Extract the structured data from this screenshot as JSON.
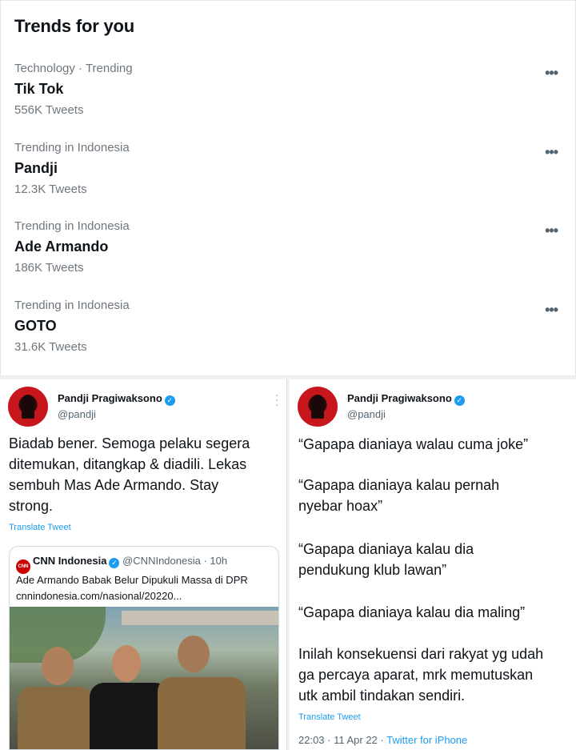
{
  "trends": {
    "title": "Trends for you",
    "items": [
      {
        "context": "Technology · Trending",
        "name": "Tik Tok",
        "count": "556K Tweets",
        "more": "•••"
      },
      {
        "context": "Trending in Indonesia",
        "name": "Pandji",
        "count": "12.3K Tweets",
        "more": "•••"
      },
      {
        "context": "Trending in Indonesia",
        "name": "Ade Armando",
        "count": "186K Tweets",
        "more": "•••"
      },
      {
        "context": "Trending in Indonesia",
        "name": "GOTO",
        "count": "31.6K Tweets",
        "more": "•••"
      }
    ]
  },
  "tweet_left": {
    "author": "Pandji Pragiwaksono",
    "handle": "@pandji",
    "lines": [
      "Biadab bener. Semoga pelaku segera",
      "ditemukan, ditangkap & diadili. Lekas",
      "sembuh Mas Ade Armando. Stay",
      "strong."
    ],
    "translate": "Translate Tweet",
    "quote": {
      "logo": "CNN",
      "name": "CNN Indonesia",
      "handle": "@CNNIndonesia",
      "time": "· 10h",
      "title": "Ade Armando Babak Belur Dipukuli Massa di DPR",
      "link": "cnnindonesia.com/nasional/20220..."
    }
  },
  "tweet_right": {
    "author": "Pandji Pragiwaksono",
    "handle": "@pandji",
    "paragraphs": [
      [
        "“Gapapa dianiaya walau cuma joke”"
      ],
      [
        "“Gapapa dianiaya kalau pernah",
        "nyebar hoax”"
      ],
      [
        "“Gapapa dianiaya kalau dia",
        "pendukung klub lawan”"
      ],
      [
        "“Gapapa dianiaya kalau dia maling”"
      ],
      [
        "Inilah konsekuensi dari rakyat yg udah",
        "ga percaya aparat, mrk memutuskan",
        "utk ambil tindakan sendiri."
      ]
    ],
    "translate": "Translate Tweet",
    "timestamp": "22:03 · 11 Apr 22 ·",
    "source": "Twitter for iPhone"
  },
  "colors": {
    "accent": "#1d9bf0",
    "muted": "#6e767d",
    "cnn": "#cc0000"
  }
}
